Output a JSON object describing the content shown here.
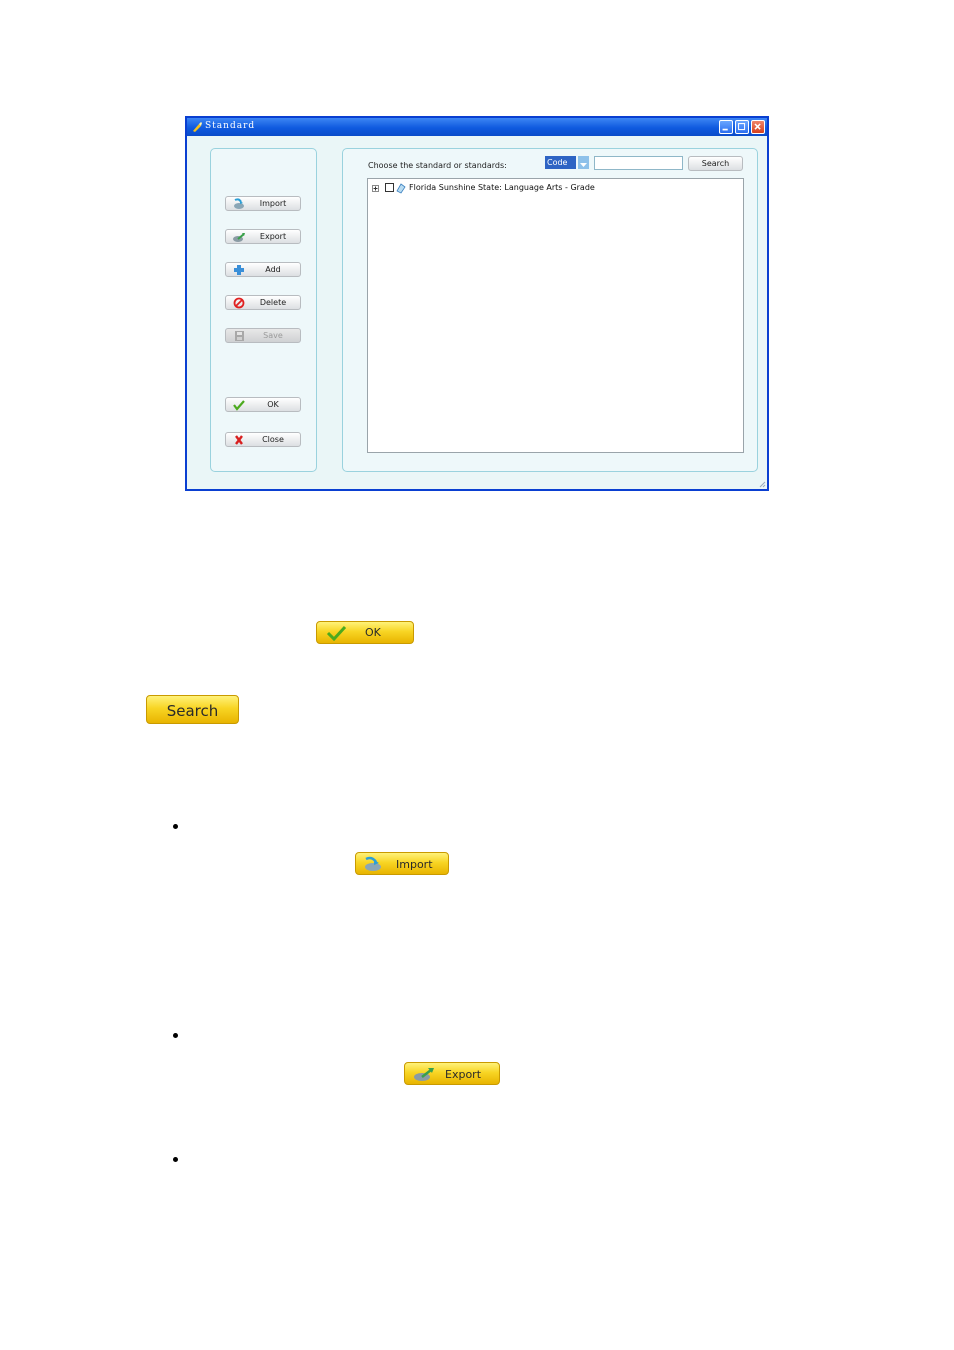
{
  "window": {
    "title": "Standard",
    "controls": [
      "minimize-icon",
      "maximize-icon",
      "close-icon"
    ]
  },
  "sidebar": {
    "buttons": [
      {
        "label": "Import",
        "icon": "import-icon",
        "enabled": true
      },
      {
        "label": "Export",
        "icon": "export-icon",
        "enabled": true
      },
      {
        "label": "Add",
        "icon": "add-icon",
        "enabled": true
      },
      {
        "label": "Delete",
        "icon": "delete-icon",
        "enabled": true
      },
      {
        "label": "Save",
        "icon": "save-icon",
        "enabled": false
      },
      {
        "label": "OK",
        "icon": "check-icon",
        "enabled": true
      },
      {
        "label": "Close",
        "icon": "close-x-icon",
        "enabled": true
      }
    ]
  },
  "main": {
    "choose_label": "Choose the standard or standards:",
    "filter_select": {
      "selected": "Code"
    },
    "search_input": {
      "value": ""
    },
    "search_button": "Search",
    "tree": [
      {
        "label": "Florida Sunshine State: Language Arts - Grade",
        "expanded": false,
        "checked": false
      }
    ]
  },
  "examples": {
    "ok_button": "OK",
    "search_button": "Search",
    "import_button": "Import",
    "export_button": "Export"
  },
  "colors": {
    "titlebar": "#0f5adf",
    "window_bg": "#eaf6f7",
    "panel_border": "#9ad2de",
    "yellow_button": "#f8d524",
    "select_highlight": "#2e64c4"
  }
}
